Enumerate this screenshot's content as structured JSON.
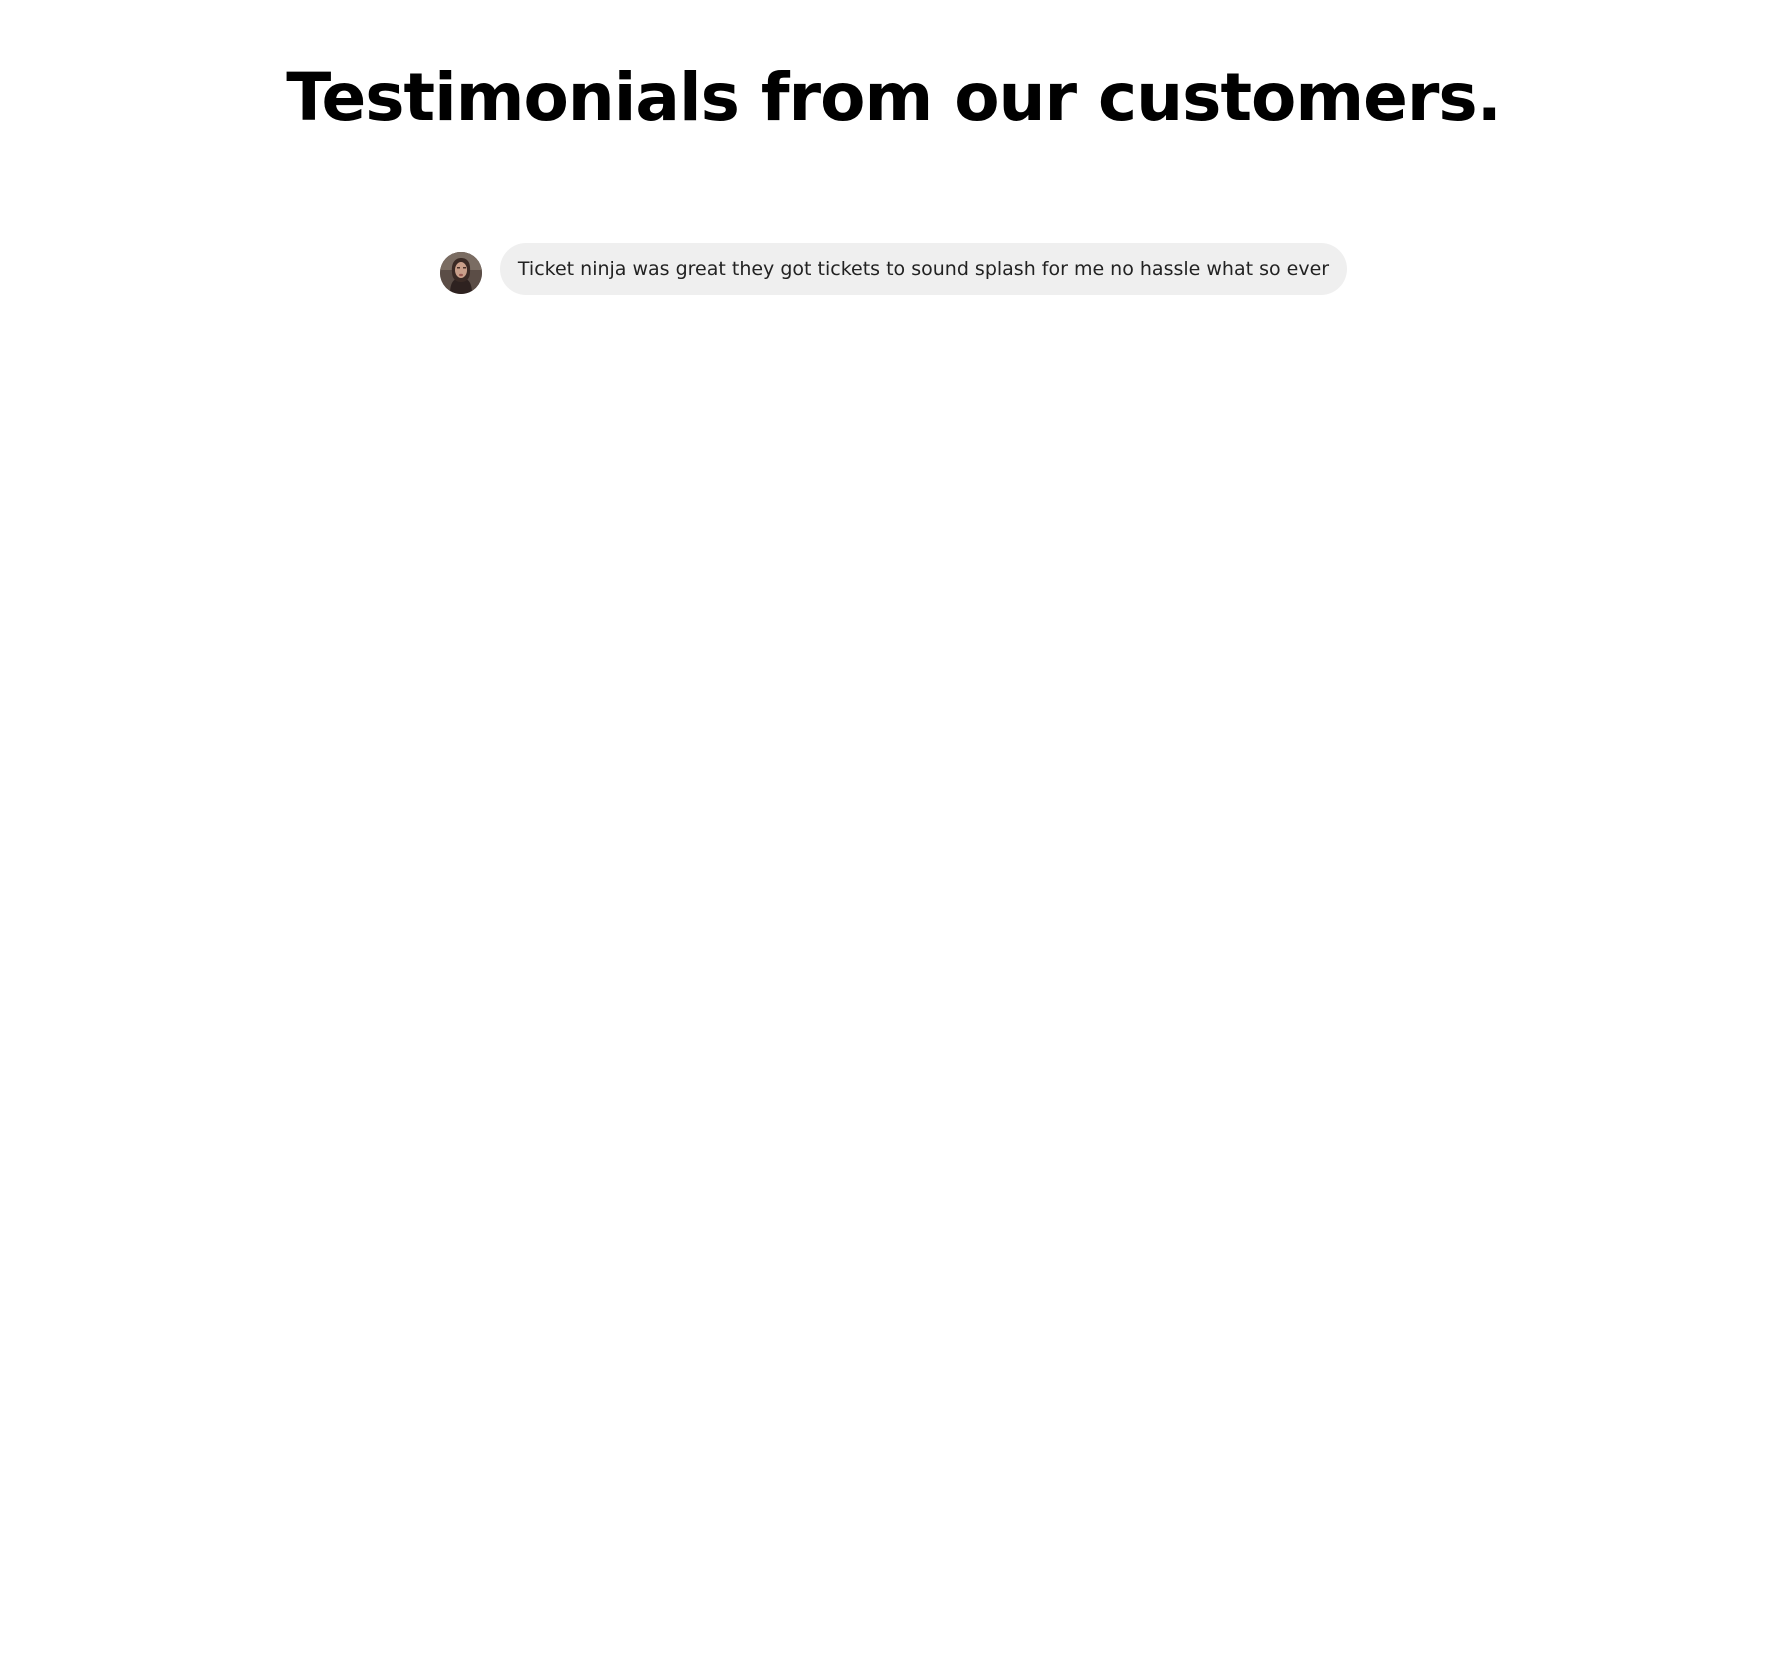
{
  "page": {
    "title": "Testimonials from our customers."
  },
  "testimonials": [
    {
      "avatar_icon": "customer-avatar-photo",
      "text": "Ticket ninja was great they got tickets to sound splash for me no hassle what so ever"
    }
  ],
  "colors": {
    "background": "#ffffff",
    "title": "#000000",
    "bubble_background": "#efefef",
    "bubble_text": "#222222"
  }
}
